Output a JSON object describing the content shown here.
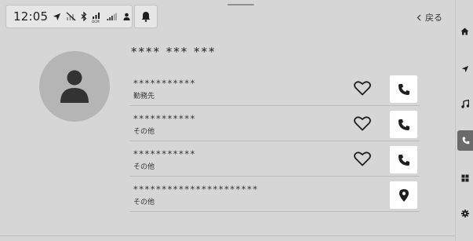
{
  "status": {
    "time": "12:05",
    "icons": [
      "navigation-arrow-icon",
      "no-data-icon",
      "bluetooth-icon",
      "dcm-signal-icon",
      "cellular-signal-icon",
      "user-icon"
    ],
    "dcm_label": "DCM",
    "notification_icon": "bell-icon"
  },
  "header": {
    "back_label": "戻る",
    "back_icon": "chevron-left-icon"
  },
  "contact": {
    "name": "**** *** ***",
    "avatar_icon": "person-icon",
    "entries": [
      {
        "number": "***********",
        "type": "勤務先",
        "favorite_icon": "heart-outline-icon",
        "action_icon": "phone-icon"
      },
      {
        "number": "***********",
        "type": "その他",
        "favorite_icon": "heart-outline-icon",
        "action_icon": "phone-icon"
      },
      {
        "number": "***********",
        "type": "その他",
        "favorite_icon": "heart-outline-icon",
        "action_icon": "phone-icon"
      },
      {
        "number": "**********************",
        "type": "その他",
        "favorite_icon": "",
        "action_icon": "map-pin-icon"
      }
    ]
  },
  "side_nav": {
    "items": [
      {
        "icon": "home-icon",
        "active": false
      },
      {
        "icon": "navigation-icon",
        "active": false
      },
      {
        "icon": "music-note-icon",
        "active": false
      },
      {
        "icon": "phone-icon",
        "active": true
      },
      {
        "icon": "apps-grid-icon",
        "active": false
      },
      {
        "icon": "gear-icon",
        "active": false
      }
    ]
  },
  "colors": {
    "background": "#d6d6d6",
    "avatar_bg": "#b5b5b5",
    "icon_dark": "#1e1e1e",
    "active_nav": "#6a6a6a",
    "button_bg": "#ffffff"
  }
}
